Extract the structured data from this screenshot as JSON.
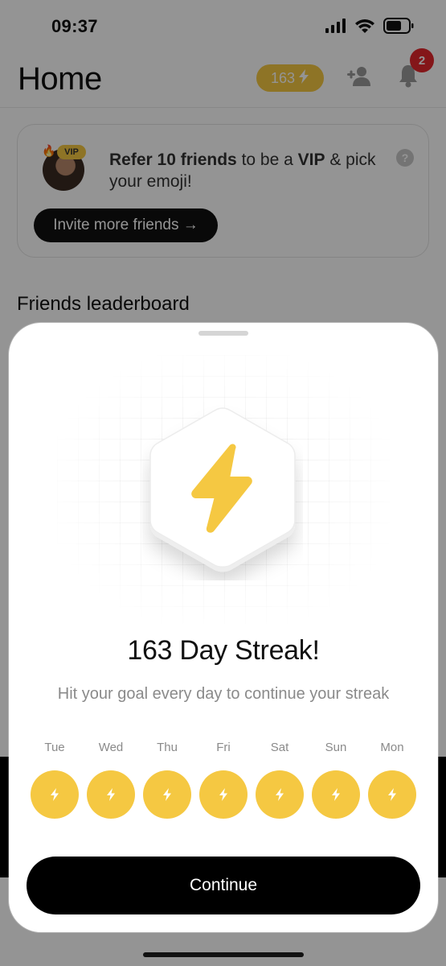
{
  "status_bar": {
    "time": "09:37"
  },
  "header": {
    "title": "Home",
    "points": "163",
    "notification_count": "2"
  },
  "refer_card": {
    "vip_label": "VIP",
    "text_bold_1": "Refer 10 friends",
    "text_1": " to be a ",
    "text_bold_2": "VIP",
    "text_2": " & pick your emoji!",
    "help": "?",
    "invite_button": "Invite more friends →"
  },
  "leaderboard": {
    "title": "Friends leaderboard"
  },
  "streak_sheet": {
    "title": "163 Day Streak!",
    "subtitle": "Hit your goal every day to continue your streak",
    "days": [
      "Tue",
      "Wed",
      "Thu",
      "Fri",
      "Sat",
      "Sun",
      "Mon"
    ],
    "continue_button": "Continue"
  },
  "colors": {
    "accent_yellow": "#f5c842",
    "badge_red": "#e3262c",
    "button_black": "#000000"
  },
  "icons": {
    "status": [
      "signal-icon",
      "wifi-icon",
      "battery-icon"
    ],
    "header": [
      "lightning-icon",
      "add-friend-icon",
      "bell-icon"
    ],
    "streak": "lightning-icon"
  }
}
